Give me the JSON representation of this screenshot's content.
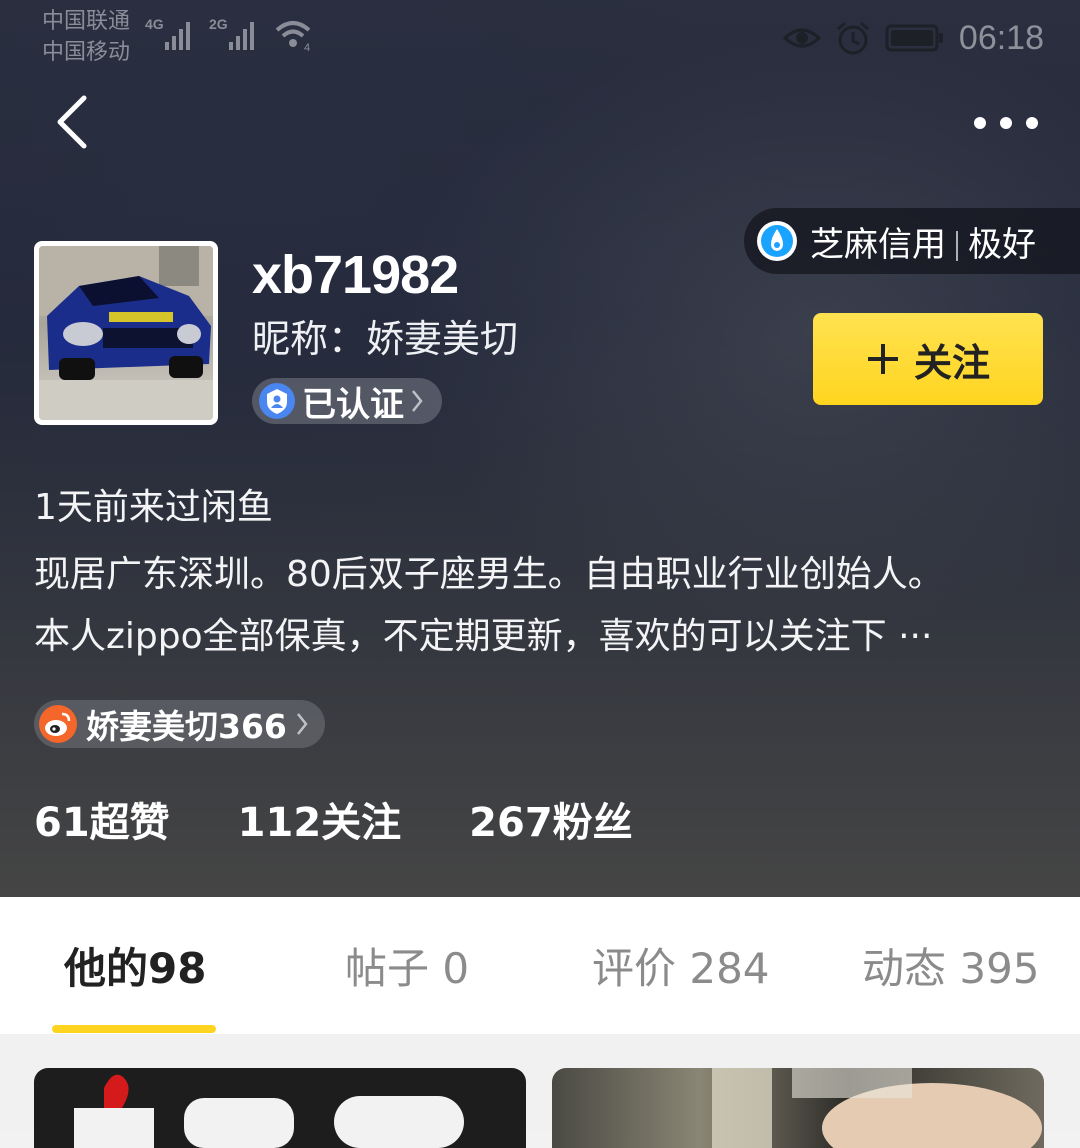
{
  "status_bar": {
    "carrier1": "中国联通",
    "carrier2": "中国移动",
    "net1": "4G",
    "net2": "2G",
    "wifi_tag": "4",
    "time": "06:18"
  },
  "nav": {
    "back_icon": "chevron-left-icon",
    "more_icon": "more-dots-icon"
  },
  "profile": {
    "username": "xb71982",
    "nickname": "昵称：娇妻美切",
    "verified_label": "已认证",
    "sesame_label": "芝麻信用",
    "sesame_level": "极好",
    "follow_label": "关注",
    "last_visit": "1天前来过闲鱼",
    "bio_line1": "现居广东深圳。80后双子座男生。自由职业行业创始人。",
    "bio_line2": "本人zippo全部保真，不定期更新，喜欢的可以关注下 ···",
    "weibo_label": "娇妻美切366"
  },
  "stats": {
    "likes": "61超赞",
    "following": "112关注",
    "fans": "267粉丝"
  },
  "tabs": [
    {
      "label": "他的98"
    },
    {
      "label": "帖子 0"
    },
    {
      "label": "评价 284"
    },
    {
      "label": "动态 395"
    }
  ],
  "colors": {
    "accent_yellow": "#ffd420",
    "sesame_blue": "#1aa3ff",
    "weibo_orange": "#f5662a"
  }
}
